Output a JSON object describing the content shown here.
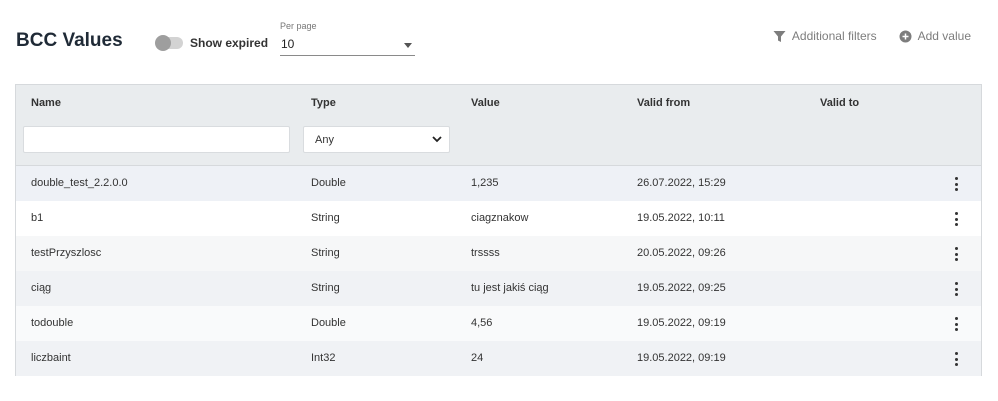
{
  "header": {
    "title": "BCC Values",
    "show_expired_label": "Show expired",
    "per_page_label": "Per page",
    "per_page_value": "10",
    "additional_filters_label": "Additional filters",
    "add_value_label": "Add value"
  },
  "table": {
    "columns": [
      "Name",
      "Type",
      "Value",
      "Valid from",
      "Valid to"
    ],
    "type_filter_value": "Any",
    "rows": [
      {
        "name": "double_test_2.2.0.0",
        "type": "Double",
        "value": "1,235",
        "valid_from": "26.07.2022, 15:29",
        "valid_to": ""
      },
      {
        "name": "b1",
        "type": "String",
        "value": "ciagznakow",
        "valid_from": "19.05.2022, 10:11",
        "valid_to": ""
      },
      {
        "name": "testPrzyszlosc",
        "type": "String",
        "value": "trssss",
        "valid_from": "20.05.2022, 09:26",
        "valid_to": ""
      },
      {
        "name": "ciąg",
        "type": "String",
        "value": "tu jest jakiś ciąg",
        "valid_from": "19.05.2022, 09:25",
        "valid_to": ""
      },
      {
        "name": "todouble",
        "type": "Double",
        "value": "4,56",
        "valid_from": "19.05.2022, 09:19",
        "valid_to": ""
      },
      {
        "name": "liczbaint",
        "type": "Int32",
        "value": "24",
        "valid_from": "19.05.2022, 09:19",
        "valid_to": ""
      }
    ]
  },
  "icons": {
    "filter": "filter-icon",
    "add": "plus-circle-icon",
    "row_menu": "more-vertical-icon"
  }
}
